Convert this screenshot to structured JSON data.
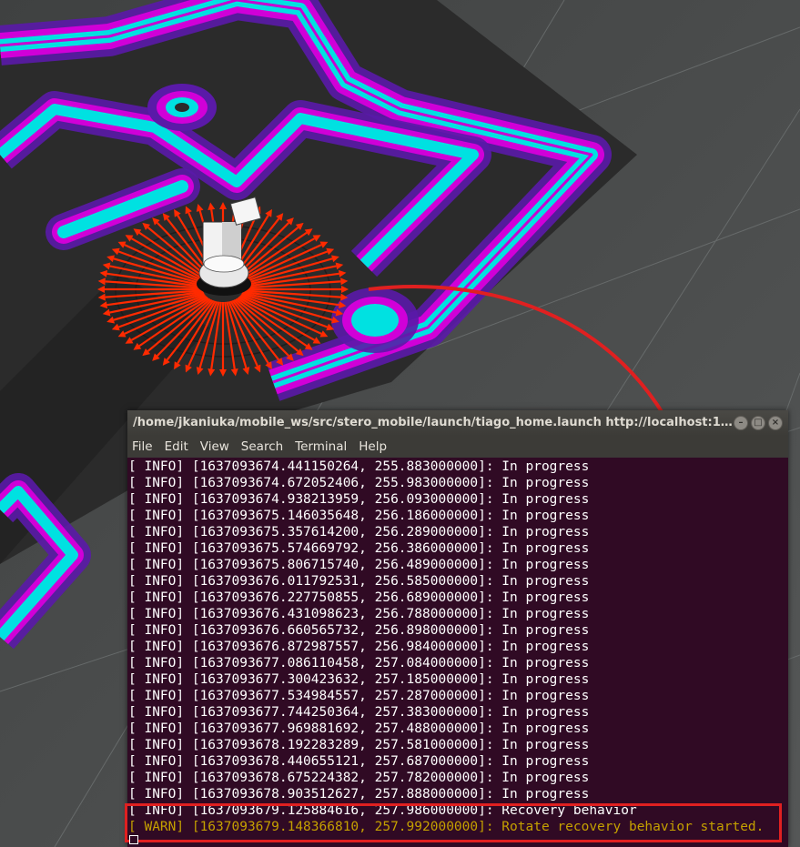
{
  "terminal": {
    "title": "/home/jkaniuka/mobile_ws/src/stero_mobile/launch/tiago_home.launch http://localhost:11...",
    "menu": [
      "File",
      "Edit",
      "View",
      "Search",
      "Terminal",
      "Help"
    ],
    "lines": [
      {
        "level": "INFO",
        "text": "[ INFO] [1637093674.441150264, 255.883000000]: In progress"
      },
      {
        "level": "INFO",
        "text": "[ INFO] [1637093674.672052406, 255.983000000]: In progress"
      },
      {
        "level": "INFO",
        "text": "[ INFO] [1637093674.938213959, 256.093000000]: In progress"
      },
      {
        "level": "INFO",
        "text": "[ INFO] [1637093675.146035648, 256.186000000]: In progress"
      },
      {
        "level": "INFO",
        "text": "[ INFO] [1637093675.357614200, 256.289000000]: In progress"
      },
      {
        "level": "INFO",
        "text": "[ INFO] [1637093675.574669792, 256.386000000]: In progress"
      },
      {
        "level": "INFO",
        "text": "[ INFO] [1637093675.806715740, 256.489000000]: In progress"
      },
      {
        "level": "INFO",
        "text": "[ INFO] [1637093676.011792531, 256.585000000]: In progress"
      },
      {
        "level": "INFO",
        "text": "[ INFO] [1637093676.227750855, 256.689000000]: In progress"
      },
      {
        "level": "INFO",
        "text": "[ INFO] [1637093676.431098623, 256.788000000]: In progress"
      },
      {
        "level": "INFO",
        "text": "[ INFO] [1637093676.660565732, 256.898000000]: In progress"
      },
      {
        "level": "INFO",
        "text": "[ INFO] [1637093676.872987557, 256.984000000]: In progress"
      },
      {
        "level": "INFO",
        "text": "[ INFO] [1637093677.086110458, 257.084000000]: In progress"
      },
      {
        "level": "INFO",
        "text": "[ INFO] [1637093677.300423632, 257.185000000]: In progress"
      },
      {
        "level": "INFO",
        "text": "[ INFO] [1637093677.534984557, 257.287000000]: In progress"
      },
      {
        "level": "INFO",
        "text": "[ INFO] [1637093677.744250364, 257.383000000]: In progress"
      },
      {
        "level": "INFO",
        "text": "[ INFO] [1637093677.969881692, 257.488000000]: In progress"
      },
      {
        "level": "INFO",
        "text": "[ INFO] [1637093678.192283289, 257.581000000]: In progress"
      },
      {
        "level": "INFO",
        "text": "[ INFO] [1637093678.440655121, 257.687000000]: In progress"
      },
      {
        "level": "INFO",
        "text": "[ INFO] [1637093678.675224382, 257.782000000]: In progress"
      },
      {
        "level": "INFO",
        "text": "[ INFO] [1637093678.903512627, 257.888000000]: In progress"
      },
      {
        "level": "INFO",
        "text": "[ INFO] [1637093679.125884616, 257.986000000]: Recovery behavior"
      },
      {
        "level": "WARN",
        "text": "[ WARN] [1637093679.148366810, 257.992000000]: Rotate recovery behavior started."
      }
    ]
  },
  "colors": {
    "terminal_bg": "#300a24",
    "warn_text": "#c4a000",
    "annotation_red": "#e02020",
    "costmap_cyan": "#00e5e5",
    "costmap_magenta": "#e000e0",
    "arrow_red": "#ff2a00"
  },
  "icons": {
    "minimize": "minimize-icon",
    "maximize": "maximize-icon",
    "close": "close-icon"
  }
}
